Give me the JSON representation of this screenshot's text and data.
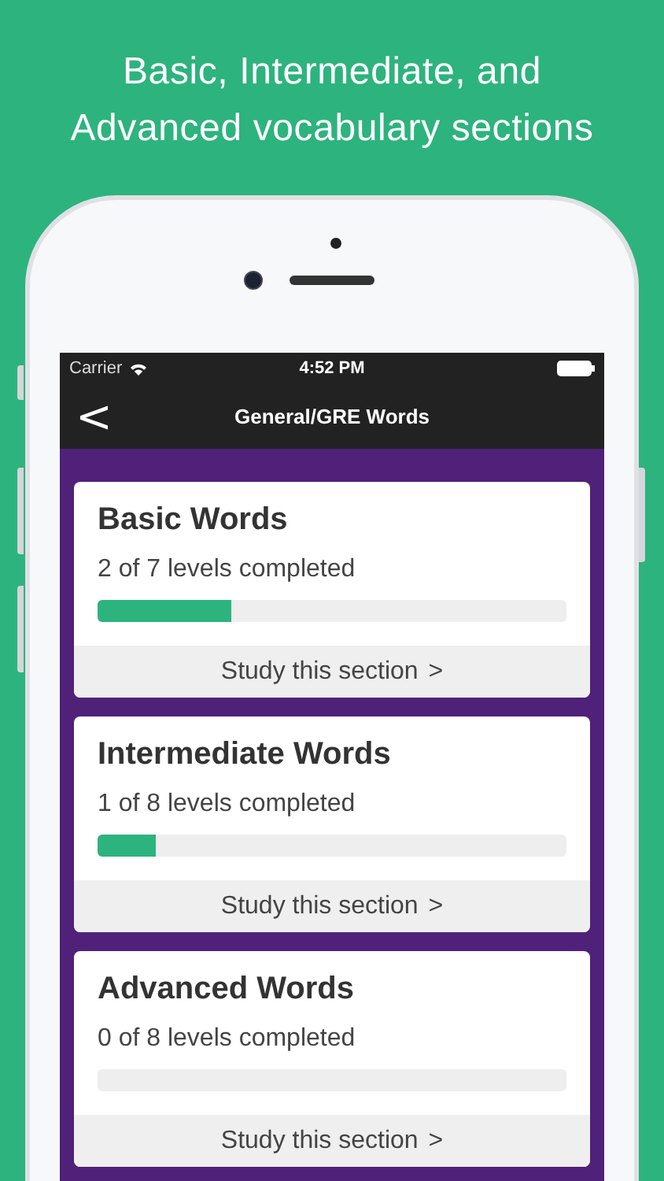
{
  "headline": "Basic, Intermediate, and Advanced vocabulary sections",
  "status_bar": {
    "carrier": "Carrier",
    "time": "4:52 PM"
  },
  "nav_bar": {
    "back": "<",
    "title": "General/GRE Words"
  },
  "sections": [
    {
      "title": "Basic Words",
      "progress": "2 of 7 levels completed",
      "level": 0.286,
      "action": "Study this section",
      "chevron": ">"
    },
    {
      "title": "Intermediate Words",
      "progress": "1 of 8 levels completed",
      "level": 0.125,
      "action": "Study this section",
      "chevron": ">"
    },
    {
      "title": "Advanced Words",
      "progress": "0 of 8 levels completed",
      "action": "Study this section",
      "chevron": ">"
    }
  ]
}
